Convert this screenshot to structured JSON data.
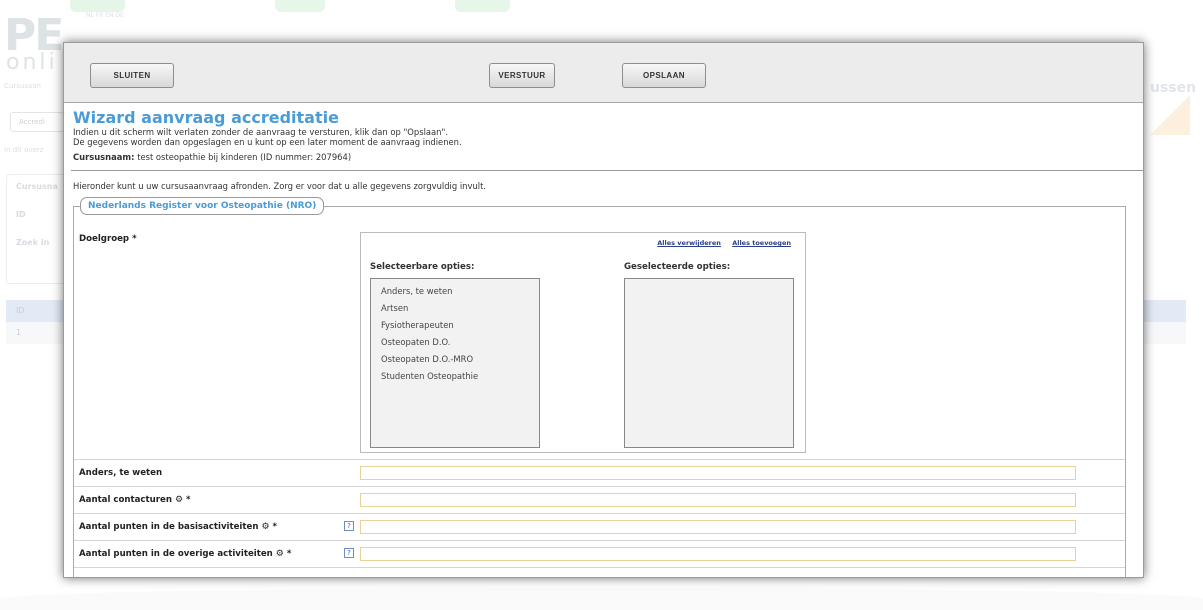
{
  "background": {
    "logo_top": "PE",
    "logo_bottom": "onli",
    "languages": "NL FR EN DE",
    "subtitle": "Cursusaan",
    "button": "Accredi",
    "overview": "In dit overz",
    "labels": [
      "Cursusna",
      "ID",
      "Zoek in"
    ],
    "table_header": "ID",
    "table_row": "1",
    "right_text": "ussen"
  },
  "toolbar": {
    "close_label": "Sluiten",
    "send_label": "Verstuur",
    "save_label": "Opslaan"
  },
  "header": {
    "title": "Wizard aanvraag accreditatie",
    "intro_line1": "Indien u dit scherm wilt verlaten zonder de aanvraag te versturen, klik dan op \"Opslaan\".",
    "intro_line2": "De gegevens worden dan opgeslagen en u kunt op een later moment de aanvraag indienen.",
    "course_label": "Cursusnaam:",
    "course_value": "test osteopathie bij kinderen (ID nummer: 207964)",
    "hint": "Hieronder kunt u uw cursusaanvraag afronden. Zorg er voor dat u alle gegevens zorgvuldig invult."
  },
  "section": {
    "legend": "Nederlands Register voor Osteopathie (NRO)",
    "target_label": "Doelgroep *",
    "remove_all": "Alles verwijderen",
    "add_all": "Alles toevoegen",
    "selectable_heading": "Selecteerbare opties:",
    "selected_heading": "Geselecteerde opties:",
    "selectable_options": [
      "Anders, te weten",
      "Artsen",
      "Fysiotherapeuten",
      "Osteopaten D.O.",
      "Osteopaten D.O.-MRO",
      "Studenten Osteopathie"
    ],
    "selected_options": [],
    "fields": [
      {
        "label": "Anders, te weten",
        "suffix": "",
        "value": ""
      },
      {
        "label": "Aantal contacturen",
        "suffix": " *",
        "value": ""
      },
      {
        "label": "Aantal punten in de basisactiviteiten",
        "suffix": " *",
        "value": ""
      },
      {
        "label": "Aantal punten in de overige activiteiten",
        "suffix": " *",
        "value": ""
      }
    ],
    "help_symbol": "?",
    "gear_symbol": "⚙"
  }
}
